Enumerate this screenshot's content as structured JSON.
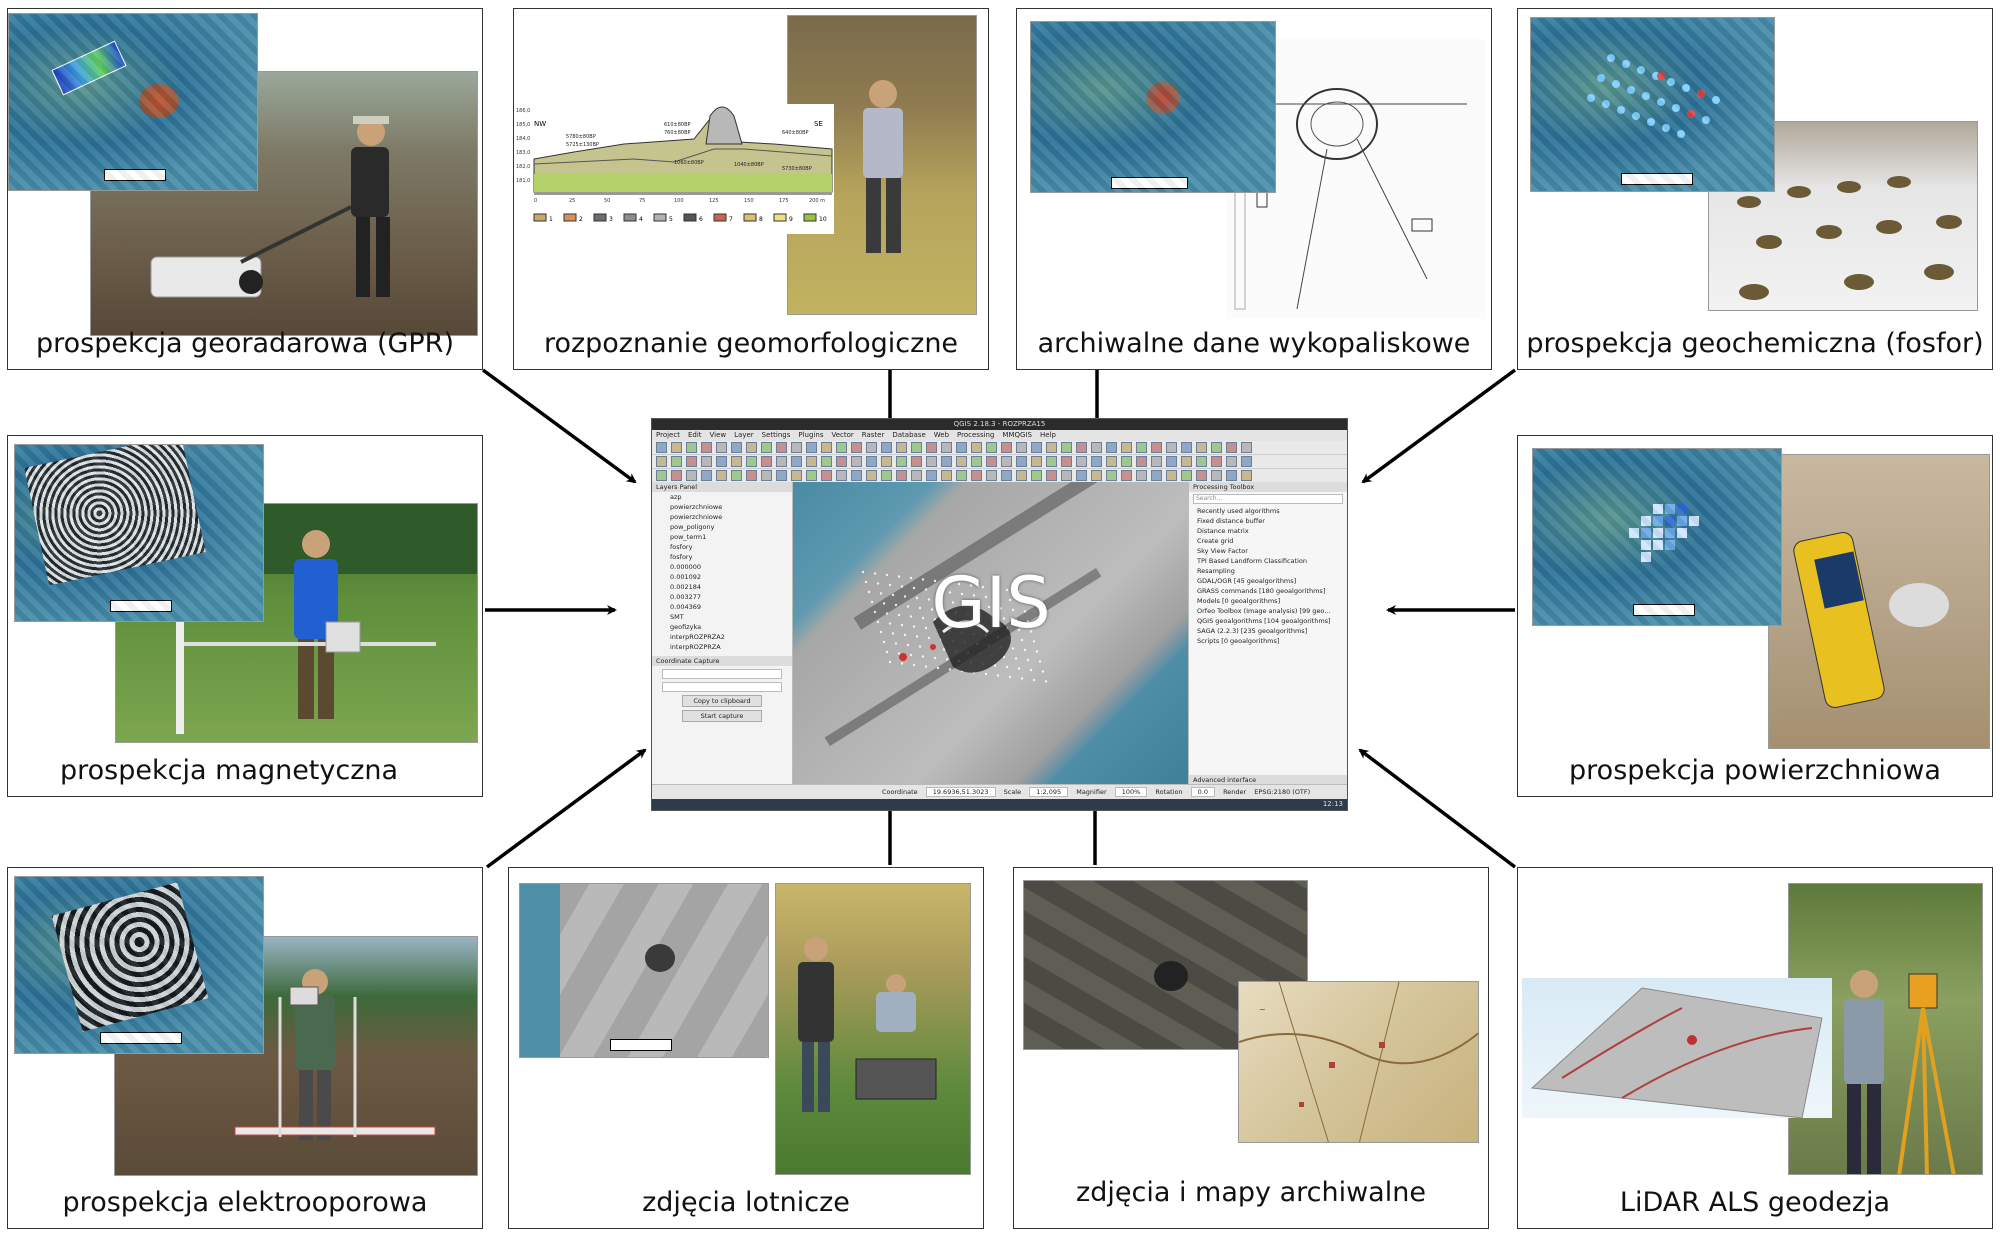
{
  "center": {
    "label": "GIS",
    "window_title": "QGIS 2.18.3 - ROZPRZA15",
    "menu": [
      "Project",
      "Edit",
      "View",
      "Layer",
      "Settings",
      "Plugins",
      "Vector",
      "Raster",
      "Database",
      "Web",
      "Processing",
      "MMQGIS",
      "Help"
    ],
    "layers_panel": {
      "title": "Layers Panel",
      "items": [
        "azp",
        "powierzchniowe",
        "powierzchniowe",
        "pow_poligony",
        "pow_term1",
        "fosfory",
        "fosfory",
        "0.000000",
        "0.001092",
        "0.002184",
        "0.003277",
        "0.004369",
        "SMT",
        "geofizyka",
        "interpROZPRZA2",
        "interpROZPRZA"
      ]
    },
    "coordinate_capture": {
      "title": "Coordinate Capture",
      "copy_label": "Copy to clipboard",
      "start_label": "Start capture"
    },
    "processing_toolbox": {
      "title": "Processing Toolbox",
      "search_placeholder": "Search...",
      "items": [
        "Recently used algorithms",
        "Fixed distance buffer",
        "Distance matrix",
        "Create grid",
        "Sky View Factor",
        "TPI Based Landform Classification",
        "Resampling",
        "GDAL/OGR [45 geoalgorithms]",
        "GRASS commands [180 geoalgorithms]",
        "Models [0 geoalgorithms]",
        "Orfeo Toolbox (Image analysis) [99 geo...",
        "QGIS geoalgorithms [104 geoalgorithms]",
        "SAGA (2.2.3) [235 geoalgorithms]",
        "Scripts [0 geoalgorithms]"
      ],
      "footer": "Advanced interface"
    },
    "status": {
      "coordinate_label": "Coordinate",
      "coordinate": "19.6936,51.3023",
      "scale_label": "Scale",
      "scale": "1:2,095",
      "magnifier_label": "Magnifier",
      "magnifier": "100%",
      "rotation_label": "Rotation",
      "rotation": "0.0",
      "render_label": "Render",
      "crs": "EPSG:2180 (OTF)"
    },
    "clock": "12:13"
  },
  "panels": [
    {
      "id": "gpr",
      "caption": "prospekcja georadarowa (GPR)"
    },
    {
      "id": "geomorph",
      "caption": "rozpoznanie geomorfologiczne"
    },
    {
      "id": "archive-dig",
      "caption": "archiwalne dane wykopaliskowe"
    },
    {
      "id": "geochem",
      "caption": "prospekcja geochemiczna (fosfor)"
    },
    {
      "id": "magnetic",
      "caption": "prospekcja magnetyczna"
    },
    {
      "id": "surface",
      "caption": "prospekcja powierzchniowa"
    },
    {
      "id": "electro",
      "caption": "prospekcja elektrooporowa"
    },
    {
      "id": "aerial",
      "caption": "zdjęcia lotnicze"
    },
    {
      "id": "maps",
      "caption": "zdjęcia i mapy archiwalne"
    },
    {
      "id": "lidar",
      "caption": "LiDAR ALS geodezja"
    }
  ],
  "profile": {
    "left_label": "NW",
    "right_label": "SE",
    "dates": [
      "5780±80BP",
      "5725±130BP",
      "610±80BP",
      "760±80BP",
      "1060±80BP",
      "1040±80BP",
      "640±80BP",
      "5730±80BP"
    ],
    "y_ticks": [
      "186,0",
      "185,0",
      "184,0",
      "183,0",
      "182,0",
      "181,0"
    ],
    "x_ticks": [
      "0",
      "25",
      "50",
      "75",
      "100",
      "125",
      "150",
      "175",
      "200 m"
    ],
    "legend": [
      "1",
      "2",
      "3",
      "4",
      "5",
      "6",
      "7",
      "8",
      "9",
      "10"
    ],
    "legend_colors": [
      "#c9a86a",
      "#d9905c",
      "#6e6e6e",
      "#8c8c8c",
      "#b0b0b0",
      "#555555",
      "#c86450",
      "#e0c070",
      "#f0e080",
      "#9ac040"
    ]
  },
  "colors": {
    "border": "#333333",
    "arrow": "#000000"
  }
}
